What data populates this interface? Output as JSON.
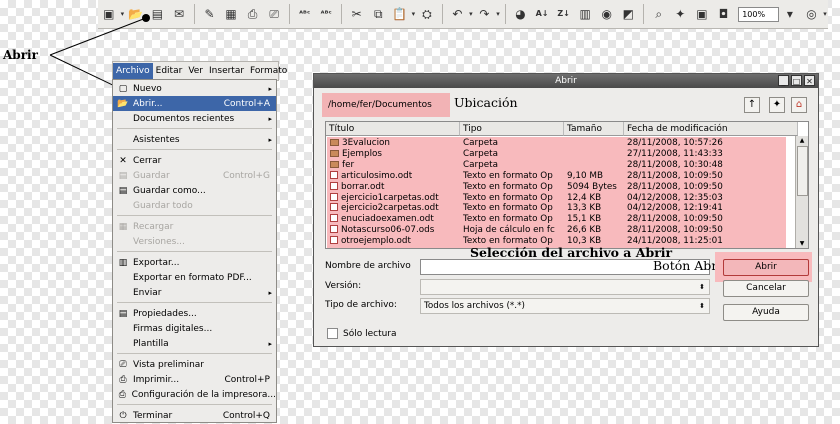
{
  "toolbar": {
    "zoom_value": "100%",
    "icons": [
      "document-icon",
      "open-folder-icon",
      "save-icon",
      "email-icon",
      "edit-icon",
      "export-pdf-icon",
      "print-icon",
      "print-preview-icon",
      "spellcheck-icon",
      "autospellcheck-icon",
      "cut-icon",
      "copy-icon",
      "paste-icon",
      "format-paintbrush-icon",
      "undo-icon",
      "redo-icon",
      "hyperlink-icon",
      "sort-ascending-icon",
      "sort-descending-icon",
      "chart-icon",
      "draw-icon",
      "find-icon",
      "navigator-icon",
      "gallery-icon",
      "datasource-icon",
      "help-icon"
    ]
  },
  "callout": {
    "label": "Abrir"
  },
  "menubar": {
    "items": [
      "Archivo",
      "Editar",
      "Ver",
      "Insertar",
      "Formato"
    ]
  },
  "file_menu": {
    "items": [
      {
        "label": "Nuevo",
        "shortcut": "",
        "submenu": "▸"
      },
      {
        "label": "Abrir...",
        "shortcut": "Control+A",
        "submenu": ""
      },
      {
        "label": "Documentos recientes",
        "shortcut": "",
        "submenu": "▸"
      },
      {
        "label": "Asistentes",
        "shortcut": "",
        "submenu": "▸"
      },
      {
        "label": "Cerrar",
        "shortcut": "",
        "submenu": ""
      },
      {
        "label": "Guardar",
        "shortcut": "Control+G",
        "submenu": ""
      },
      {
        "label": "Guardar como...",
        "shortcut": "",
        "submenu": ""
      },
      {
        "label": "Guardar todo",
        "shortcut": "",
        "submenu": ""
      },
      {
        "label": "Recargar",
        "shortcut": "",
        "submenu": ""
      },
      {
        "label": "Versiones...",
        "shortcut": "",
        "submenu": ""
      },
      {
        "label": "Exportar...",
        "shortcut": "",
        "submenu": ""
      },
      {
        "label": "Exportar en formato PDF...",
        "shortcut": "",
        "submenu": ""
      },
      {
        "label": "Enviar",
        "shortcut": "",
        "submenu": "▸"
      },
      {
        "label": "Propiedades...",
        "shortcut": "",
        "submenu": ""
      },
      {
        "label": "Firmas digitales...",
        "shortcut": "",
        "submenu": ""
      },
      {
        "label": "Plantilla",
        "shortcut": "",
        "submenu": "▸"
      },
      {
        "label": "Vista preliminar",
        "shortcut": "",
        "submenu": ""
      },
      {
        "label": "Imprimir...",
        "shortcut": "Control+P",
        "submenu": ""
      },
      {
        "label": "Configuración de la impresora...",
        "shortcut": "",
        "submenu": ""
      },
      {
        "label": "Terminar",
        "shortcut": "Control+Q",
        "submenu": ""
      }
    ]
  },
  "dialog": {
    "title": "Abrir",
    "path": "/home/fer/Documentos",
    "location_label": "Ubicación",
    "columns": [
      "Título",
      "Tipo",
      "Tamaño",
      "Fecha de modificación"
    ],
    "files": [
      {
        "name": "3Evalucion",
        "type": "Carpeta",
        "size": "",
        "date": "28/11/2008, 10:57:26",
        "kind": "folder"
      },
      {
        "name": "Ejemplos",
        "type": "Carpeta",
        "size": "",
        "date": "27/11/2008, 11:43:33",
        "kind": "folder"
      },
      {
        "name": "fer",
        "type": "Carpeta",
        "size": "",
        "date": "28/11/2008, 10:30:48",
        "kind": "folder"
      },
      {
        "name": "articulosimo.odt",
        "type": "Texto en formato Op",
        "size": "9,10 MB",
        "date": "28/11/2008, 10:09:50",
        "kind": "file"
      },
      {
        "name": "borrar.odt",
        "type": "Texto en formato Op",
        "size": "5094 Bytes",
        "date": "28/11/2008, 10:09:50",
        "kind": "file"
      },
      {
        "name": "ejercicio1carpetas.odt",
        "type": "Texto en formato Op",
        "size": "12,4 KB",
        "date": "04/12/2008, 12:35:03",
        "kind": "file"
      },
      {
        "name": "ejercicio2carpetas.odt",
        "type": "Texto en formato Op",
        "size": "13,3 KB",
        "date": "04/12/2008, 12:19:41",
        "kind": "file"
      },
      {
        "name": "enuciadoexamen.odt",
        "type": "Texto en formato Op",
        "size": "15,1 KB",
        "date": "28/11/2008, 10:09:50",
        "kind": "file"
      },
      {
        "name": "Notascurso06-07.ods",
        "type": "Hoja de cálculo en fc",
        "size": "26,6 KB",
        "date": "28/11/2008, 10:09:50",
        "kind": "file"
      },
      {
        "name": "otroejemplo.odt",
        "type": "Texto en formato Op",
        "size": "10,3 KB",
        "date": "24/11/2008, 11:25:01",
        "kind": "file"
      }
    ],
    "selection_label": "Selección del archivo a Abrir",
    "filename_label": "Nombre de archivo",
    "filename_value": "",
    "button_annotation": "Botón Abrir",
    "version_label": "Versión:",
    "version_value": "",
    "filetype_label": "Tipo de archivo:",
    "filetype_value": "Todos los archivos (*.*)",
    "readonly_label": "Sólo lectura",
    "buttons": {
      "open": "Abrir",
      "cancel": "Cancelar",
      "help": "Ayuda"
    }
  },
  "colors": {
    "highlight_pink": "#f8babd",
    "menu_selection": "#3d66a8"
  }
}
